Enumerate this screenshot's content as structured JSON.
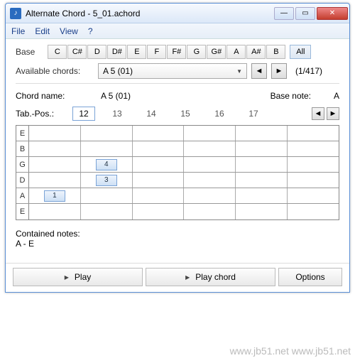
{
  "title": "Alternate Chord - 5_01.achord",
  "icon_glyph": "♪",
  "menu": {
    "file": "File",
    "edit": "Edit",
    "view": "View",
    "help": "?"
  },
  "base": {
    "label": "Base",
    "notes": [
      "C",
      "C#",
      "D",
      "D#",
      "E",
      "F",
      "F#",
      "G",
      "G#",
      "A",
      "A#",
      "B"
    ],
    "all": "All"
  },
  "available": {
    "label": "Available chords:",
    "selected": "A 5 (01)",
    "counter": "(1/417)"
  },
  "chord": {
    "name_label": "Chord name:",
    "name": "A 5 (01)",
    "basenote_label": "Base note:",
    "basenote": "A"
  },
  "tab": {
    "label": "Tab.-Pos.:",
    "pos": "12",
    "fret_labels": [
      "13",
      "14",
      "15",
      "16",
      "17"
    ]
  },
  "strings": [
    "E",
    "B",
    "G",
    "D",
    "A",
    "E"
  ],
  "fingers": {
    "G": {
      "col": 1,
      "label": "4"
    },
    "D": {
      "col": 1,
      "label": "3"
    },
    "A": {
      "col": 0,
      "label": "1"
    }
  },
  "contained": {
    "label": "Contained notes:",
    "value": "A - E"
  },
  "buttons": {
    "play": "Play",
    "play_chord": "Play chord",
    "options": "Options"
  },
  "nav": {
    "left": "◄",
    "right": "►",
    "dd": "▼"
  },
  "watermark": "www.jb51.net\nwww.jb51.net"
}
